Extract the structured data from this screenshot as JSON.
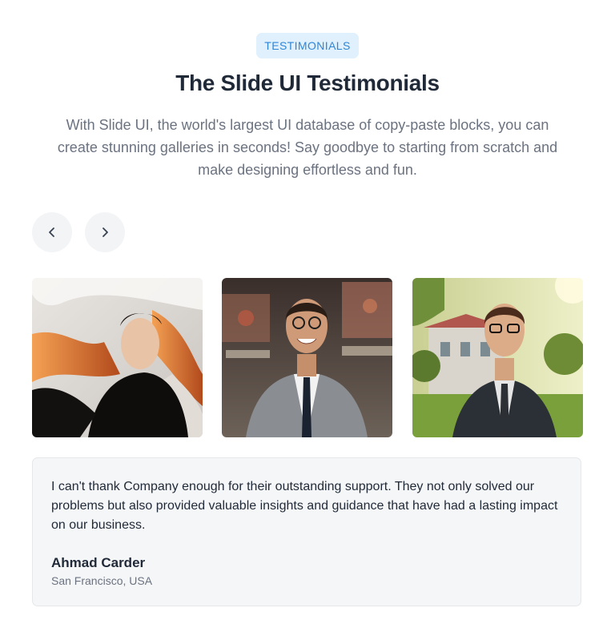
{
  "header": {
    "badge": "TESTIMONIALS",
    "title": "The Slide UI Testimonials",
    "subtitle": "With Slide UI, the world's largest UI database of copy-paste blocks, you can create stunning galleries in seconds! Say goodbye to starting from scratch and make designing effortless and fun."
  },
  "navigation": {
    "prev_icon": "chevron-left-icon",
    "next_icon": "chevron-right-icon"
  },
  "gallery": [
    {
      "subject": "woman-portrait"
    },
    {
      "subject": "man-portrait"
    },
    {
      "subject": "man-portrait"
    }
  ],
  "testimonial": {
    "quote": "I can't thank Company enough for their outstanding support. They not only solved our problems but also provided valuable insights and guidance that have had a lasting impact on our business.",
    "author": "Ahmad Carder",
    "location": "San Francisco, USA"
  },
  "colors": {
    "accent": "#2f86d6",
    "badge_bg": "#e0f0fd",
    "card_bg": "#f5f6f8",
    "button_bg": "#f3f4f6"
  }
}
